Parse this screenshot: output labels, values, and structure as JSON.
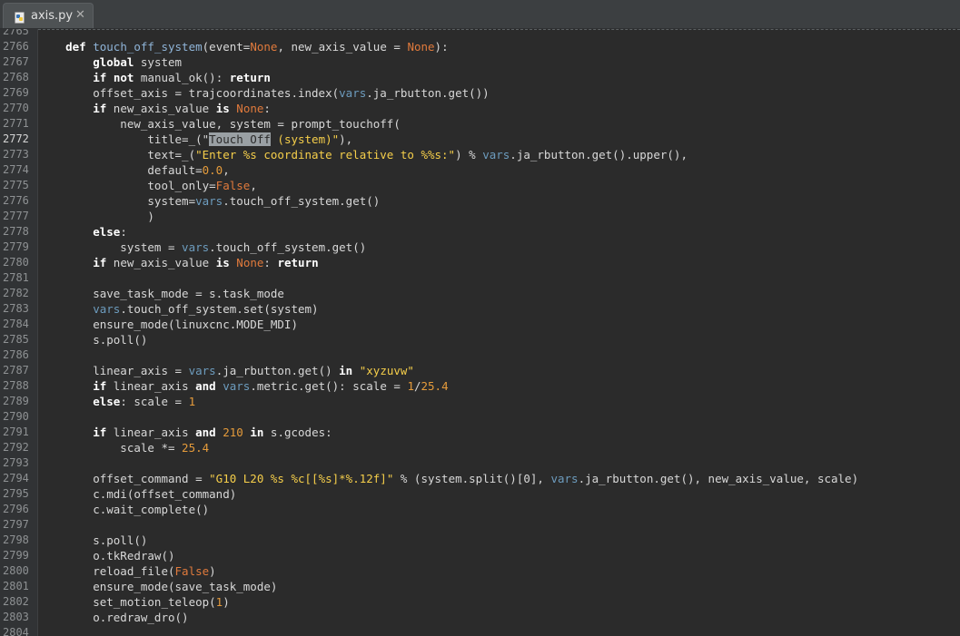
{
  "tab": {
    "filename": "axis.py",
    "close_glyph": "✕"
  },
  "line_numbers": [
    "2765",
    "2766",
    "2767",
    "2768",
    "2769",
    "2770",
    "2771",
    "2772",
    "2773",
    "2774",
    "2775",
    "2776",
    "2777",
    "2778",
    "2779",
    "2780",
    "2781",
    "2782",
    "2783",
    "2784",
    "2785",
    "2786",
    "2787",
    "2788",
    "2789",
    "2790",
    "2791",
    "2792",
    "2793",
    "2794",
    "2795",
    "2796",
    "2797",
    "2798",
    "2799",
    "2800",
    "2801",
    "2802",
    "2803",
    "2804"
  ],
  "current_line": "2772",
  "code": [
    [],
    [
      [
        "    ",
        ""
      ],
      [
        "def",
        "kw"
      ],
      [
        " ",
        ""
      ],
      [
        "touch_off_system",
        "fn"
      ],
      [
        "(event=",
        ""
      ],
      [
        "None",
        "none"
      ],
      [
        ", new_axis_value = ",
        ""
      ],
      [
        "None",
        "none"
      ],
      [
        "):",
        ""
      ]
    ],
    [
      [
        "        ",
        ""
      ],
      [
        "global",
        "kw"
      ],
      [
        " system",
        ""
      ]
    ],
    [
      [
        "        ",
        ""
      ],
      [
        "if",
        "kw"
      ],
      [
        " ",
        ""
      ],
      [
        "not",
        "kw"
      ],
      [
        " manual_ok(): ",
        ""
      ],
      [
        "return",
        "kw"
      ]
    ],
    [
      [
        "        offset_axis = trajcoordinates.index(",
        ""
      ],
      [
        "vars",
        "var"
      ],
      [
        ".ja_rbutton.get())",
        ""
      ]
    ],
    [
      [
        "        ",
        ""
      ],
      [
        "if",
        "kw"
      ],
      [
        " new_axis_value ",
        ""
      ],
      [
        "is",
        "kw"
      ],
      [
        " ",
        ""
      ],
      [
        "None",
        "none"
      ],
      [
        ":",
        ""
      ]
    ],
    [
      [
        "            new_axis_value, system = prompt_touchoff(",
        ""
      ]
    ],
    [
      [
        "                title=_(",
        ""
      ],
      [
        "\"",
        ""
      ],
      [
        "Touch Off",
        "sel"
      ],
      [
        " (system)\"",
        "str"
      ],
      [
        "),",
        ""
      ]
    ],
    [
      [
        "                text=_(",
        ""
      ],
      [
        "\"Enter %s coordinate relative to %%s:\"",
        "str"
      ],
      [
        ") % ",
        ""
      ],
      [
        "vars",
        "var"
      ],
      [
        ".ja_rbutton.get().upper(),",
        ""
      ]
    ],
    [
      [
        "                default=",
        ""
      ],
      [
        "0.0",
        "num"
      ],
      [
        ",",
        ""
      ]
    ],
    [
      [
        "                tool_only=",
        ""
      ],
      [
        "False",
        "none"
      ],
      [
        ",",
        ""
      ]
    ],
    [
      [
        "                system=",
        ""
      ],
      [
        "vars",
        "var"
      ],
      [
        ".touch_off_system.get()",
        ""
      ]
    ],
    [
      [
        "                )",
        ""
      ]
    ],
    [
      [
        "        ",
        ""
      ],
      [
        "else",
        "kw"
      ],
      [
        ":",
        ""
      ]
    ],
    [
      [
        "            system = ",
        ""
      ],
      [
        "vars",
        "var"
      ],
      [
        ".touch_off_system.get()",
        ""
      ]
    ],
    [
      [
        "        ",
        ""
      ],
      [
        "if",
        "kw"
      ],
      [
        " new_axis_value ",
        ""
      ],
      [
        "is",
        "kw"
      ],
      [
        " ",
        ""
      ],
      [
        "None",
        "none"
      ],
      [
        ": ",
        ""
      ],
      [
        "return",
        "kw"
      ]
    ],
    [],
    [
      [
        "        save_task_mode = s.task_mode",
        ""
      ]
    ],
    [
      [
        "        ",
        ""
      ],
      [
        "vars",
        "var"
      ],
      [
        ".touch_off_system.set(system)",
        ""
      ]
    ],
    [
      [
        "        ensure_mode(linuxcnc.MODE_MDI)",
        ""
      ]
    ],
    [
      [
        "        s.poll()",
        ""
      ]
    ],
    [],
    [
      [
        "        linear_axis = ",
        ""
      ],
      [
        "vars",
        "var"
      ],
      [
        ".ja_rbutton.get() ",
        ""
      ],
      [
        "in",
        "kw"
      ],
      [
        " ",
        ""
      ],
      [
        "\"xyzuvw\"",
        "str"
      ]
    ],
    [
      [
        "        ",
        ""
      ],
      [
        "if",
        "kw"
      ],
      [
        " linear_axis ",
        ""
      ],
      [
        "and",
        "kw"
      ],
      [
        " ",
        ""
      ],
      [
        "vars",
        "var"
      ],
      [
        ".metric.get(): scale = ",
        ""
      ],
      [
        "1",
        "num"
      ],
      [
        "/",
        ""
      ],
      [
        "25.4",
        "num"
      ]
    ],
    [
      [
        "        ",
        ""
      ],
      [
        "else",
        "kw"
      ],
      [
        ": scale = ",
        ""
      ],
      [
        "1",
        "num"
      ]
    ],
    [],
    [
      [
        "        ",
        ""
      ],
      [
        "if",
        "kw"
      ],
      [
        " linear_axis ",
        ""
      ],
      [
        "and",
        "kw"
      ],
      [
        " ",
        ""
      ],
      [
        "210",
        "num"
      ],
      [
        " ",
        ""
      ],
      [
        "in",
        "kw"
      ],
      [
        " s.gcodes:",
        ""
      ]
    ],
    [
      [
        "            scale *= ",
        ""
      ],
      [
        "25.4",
        "num"
      ]
    ],
    [],
    [
      [
        "        offset_command = ",
        ""
      ],
      [
        "\"G10 L20 %s %c[[%s]*%.12f]\"",
        "str"
      ],
      [
        " % (system.split()[0], ",
        ""
      ],
      [
        "vars",
        "var"
      ],
      [
        ".ja_rbutton.get(), new_axis_value, scale)",
        ""
      ]
    ],
    [
      [
        "        c.mdi(offset_command)",
        ""
      ]
    ],
    [
      [
        "        c.wait_complete()",
        ""
      ]
    ],
    [],
    [
      [
        "        s.poll()",
        ""
      ]
    ],
    [
      [
        "        o.tkRedraw()",
        ""
      ]
    ],
    [
      [
        "        reload_file(",
        ""
      ],
      [
        "False",
        "none"
      ],
      [
        ")",
        ""
      ]
    ],
    [
      [
        "        ensure_mode(save_task_mode)",
        ""
      ]
    ],
    [
      [
        "        set_motion_teleop(",
        ""
      ],
      [
        "1",
        "num"
      ],
      [
        ")",
        ""
      ]
    ],
    [
      [
        "        o.redraw_dro()",
        ""
      ]
    ],
    []
  ]
}
